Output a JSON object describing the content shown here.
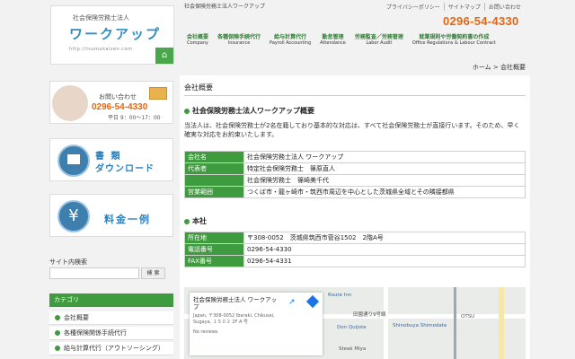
{
  "header": {
    "tagline": "社会保険労務士法人ワークアップ",
    "toplinks": [
      "プライバシーポリシー",
      "サイトマップ",
      "お問い合わせ"
    ],
    "phone": "0296-54-4330",
    "logo": {
      "sub": "社会保険労務士法人",
      "main": "ワークアップ",
      "url": "http://tsumukaizen.com"
    },
    "nav": [
      {
        "jp": "会社概要",
        "en": "Company"
      },
      {
        "jp": "各種保険手続代行",
        "en": "Insurance"
      },
      {
        "jp": "給与計算代行",
        "en": "Payroll Accounting"
      },
      {
        "jp": "勤怠管理",
        "en": "Attendance"
      },
      {
        "jp": "労務監査／労務管理",
        "en": "Labor Audit"
      },
      {
        "jp": "就業規則や労働契約書の作成",
        "en": "Office Regulations & Labour Contract"
      }
    ]
  },
  "breadcrumb": "ホーム > 会社概要",
  "main": {
    "title": "会社概要",
    "section1": "社会保険労務士法人ワークアップ概要",
    "intro": "当法人は、社会保険労務士が2名在籍しており基本的な対応は、すべて社会保険労務士が直接行います。そのため、早く確実な対応をお約束いたします。",
    "table1": [
      {
        "label": "会社名",
        "value": "社会保険労務士法人 ワークアップ"
      },
      {
        "label": "代表者",
        "value": "特定社会保険労務士　篠原直人"
      },
      {
        "label": "",
        "value": "社会保険労務士　篠崎美千代"
      },
      {
        "label": "営業範囲",
        "value": "つくば市・龍ヶ崎市・筑西市周辺を中心とした茨城県全域とその隣接都県"
      }
    ],
    "section2": "本社",
    "table2": [
      {
        "label": "所在地",
        "value": "〒308-0052　茨城県筑西市菅谷1502　2階A号"
      },
      {
        "label": "電話番号",
        "value": "0296-54-4330"
      },
      {
        "label": "FAX番号",
        "value": "0296-54-4331"
      }
    ],
    "map": {
      "name": "社会保険労務士法人 ワークアップ",
      "address": "Japan, 〒308-0052 Ibaraki, Chikusei, Sugaya, １５０２ 2F A 号",
      "reviews": "No reviews",
      "labels": [
        "Route Inn",
        "田園通り9号線",
        "Don Quijote",
        "Shinobuya Shimodate",
        "Steak Miya",
        "OTSU"
      ]
    }
  },
  "sidebar": {
    "contact": {
      "label": "お問い合わせ",
      "phone": "0296-54-4330",
      "hours": "平日 9：00～17：00"
    },
    "download": {
      "line1": "書 類",
      "line2": "ダウンロード"
    },
    "fees": "料金一例",
    "search_label": "サイト内検索",
    "search_button": "検 索",
    "category_head": "カテゴリ",
    "categories": [
      "会社概要",
      "各種保険関係手続代行",
      "給与計算代行（アウトソーシング）"
    ]
  },
  "colors": {
    "green": "#3e9b3e",
    "orange": "#e5660f",
    "blue": "#2e8fc6"
  }
}
